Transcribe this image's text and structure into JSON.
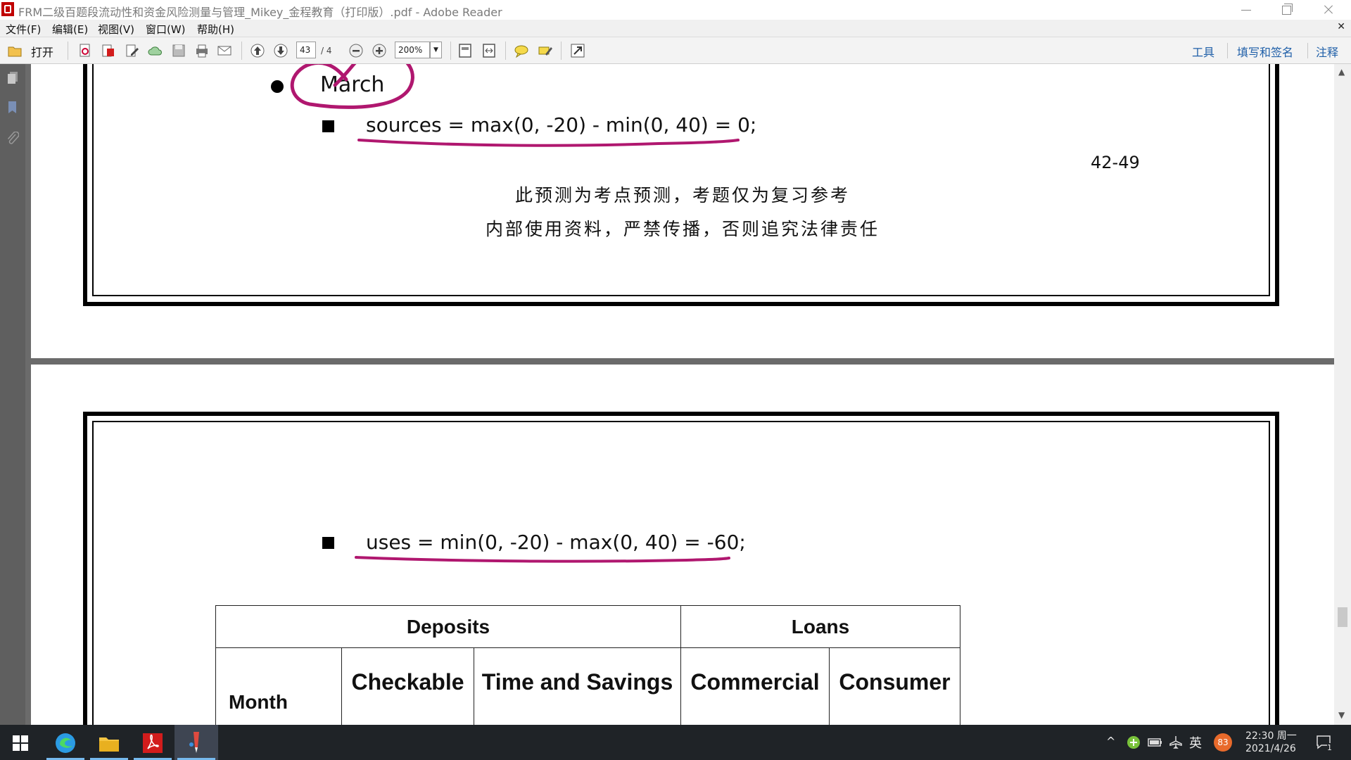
{
  "window": {
    "title": "FRM二级百题段流动性和资金风险测量与管理_Mikey_金程教育（打印版）.pdf - Adobe Reader"
  },
  "menu": {
    "file": "文件(F)",
    "edit": "编辑(E)",
    "view": "视图(V)",
    "window": "窗口(W)",
    "help": "帮助(H)"
  },
  "toolbar": {
    "open_label": "打开",
    "page_number": "43",
    "page_total": "/ 4",
    "zoom_value": "200%",
    "tools_label": "工具",
    "fill_sign_label": "填写和签名",
    "comment_label": "注释"
  },
  "page1": {
    "bullet_text": "March",
    "formula": "sources = max(0, -20) - min(0, 40) = 0;",
    "page_ref": "42-49",
    "notice_line1": "此预测为考点预测，考题仅为复习参考",
    "notice_line2": "内部使用资料，严禁传播，否则追究法律责任"
  },
  "page2": {
    "formula": "uses = min(0, -20) - max(0, 40) = -60;",
    "table": {
      "group_headers": [
        "Deposits",
        "Loans"
      ],
      "column_headers": [
        "Month",
        "Checkable",
        "Time and Savings",
        "Commercial",
        "Consumer"
      ]
    }
  },
  "annotations": {
    "ink_color": "#b0176f"
  },
  "taskbar": {
    "time": "22:30 周一",
    "date": "2021/4/26",
    "ime_label": "英",
    "battery_badge": "83",
    "notification_count": "1"
  }
}
